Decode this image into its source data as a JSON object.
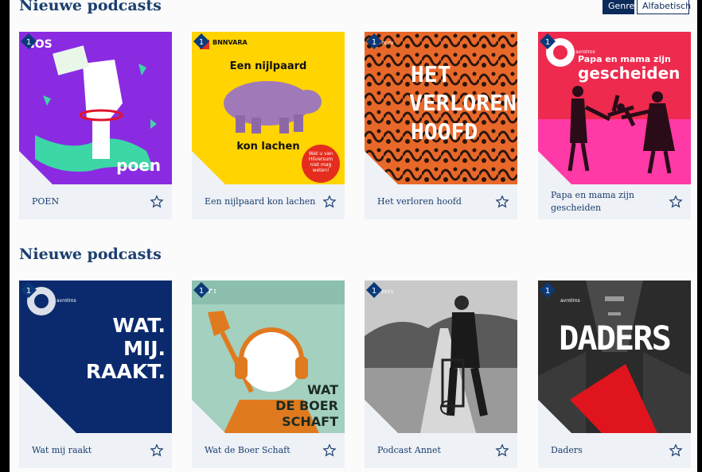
{
  "sections": [
    {
      "title": "Nieuwe podcasts",
      "cards": [
        {
          "label": "POEN",
          "art_text": [
            "poen"
          ],
          "brand": "NOS"
        },
        {
          "label": "Een nijlpaard kon lachen",
          "art_text": [
            "Een nijlpaard",
            "kon lachen"
          ],
          "brand": "BNNVARA",
          "sticker": [
            "Wat u van",
            "Hilversum",
            "niet mag",
            "weten!"
          ]
        },
        {
          "label": "Het verloren hoofd",
          "art_text": [
            "HET",
            "VERLOREN",
            "HOOFD"
          ],
          "brand": "kro ncrv"
        },
        {
          "label": "Papa en mama zijn gescheiden",
          "art_text": [
            "Papa en mama zijn",
            "gescheiden"
          ],
          "brand": "avrotros"
        }
      ]
    },
    {
      "title": "Nieuwe podcasts",
      "cards": [
        {
          "label": "Wat mij raakt",
          "art_text": [
            "WAT.",
            "MIJ.",
            "RAAKT."
          ],
          "brand": "avrotros"
        },
        {
          "label": "Wat de Boer Schaft",
          "art_text": [
            "WAT",
            "DE BOER",
            "SCHAFT"
          ],
          "brand": "ntr:"
        },
        {
          "label": "Podcast Annet",
          "art_text": [],
          "brand": "kro ncrv"
        },
        {
          "label": "Daders",
          "art_text": [
            "DADERS"
          ],
          "brand": "avrotros"
        }
      ]
    }
  ],
  "sort_toggle": {
    "genre": "Genre",
    "alphabetical": "Alfabetisch"
  },
  "icons": {
    "favorite": "star-outline-icon",
    "channel": "npo-1-badge-icon"
  },
  "colors": {
    "title": "#1a3e6e",
    "caption_bg": "#eef1f6",
    "toggle_active": "#0b2a5a"
  }
}
